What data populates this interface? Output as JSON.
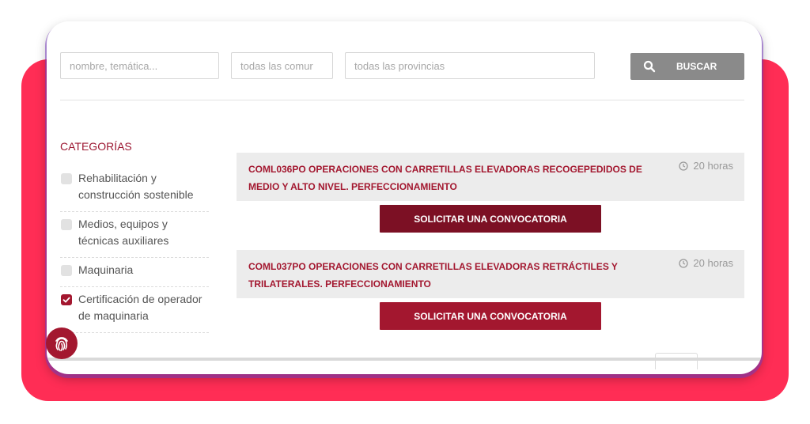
{
  "search": {
    "keyword_placeholder": "nombre, temática...",
    "community_placeholder": "todas las comur",
    "province_placeholder": "todas las provincias",
    "button_label": "BUSCAR",
    "button_icon": "search-icon"
  },
  "sidebar": {
    "title": "CATEGORÍAS",
    "items": [
      {
        "label": "Rehabilitación y construcción sostenible",
        "checked": false
      },
      {
        "label": "Medios, equipos y técnicas auxiliares",
        "checked": false
      },
      {
        "label": "Maquinaria",
        "checked": false
      },
      {
        "label": "Certificación de operador de maquinaria",
        "checked": true
      }
    ]
  },
  "courses": [
    {
      "title": "COML036PO OPERACIONES CON CARRETILLAS ELEVADORAS RECOGEPEDIDOS DE MEDIO Y ALTO NIVEL. PERFECCIONAMIENTO",
      "hours": "20 horas",
      "button_label": "SOLICITAR UNA CONVOCATORIA"
    },
    {
      "title": "COML037PO OPERACIONES CON CARRETILLAS ELEVADORAS RETRÁCTILES Y TRILATERALES. PERFECCIONAMIENTO",
      "hours": "20 horas",
      "button_label": "SOLICITAR UNA CONVOCATORIA"
    }
  ],
  "colors": {
    "accent": "#a3172f",
    "accent_dark": "#7c1024",
    "backdrop": "#ff2d55",
    "search_button": "#8a8a8a"
  },
  "icons": {
    "clock": "clock-icon",
    "fingerprint": "fingerprint-icon",
    "check": "check-icon"
  }
}
